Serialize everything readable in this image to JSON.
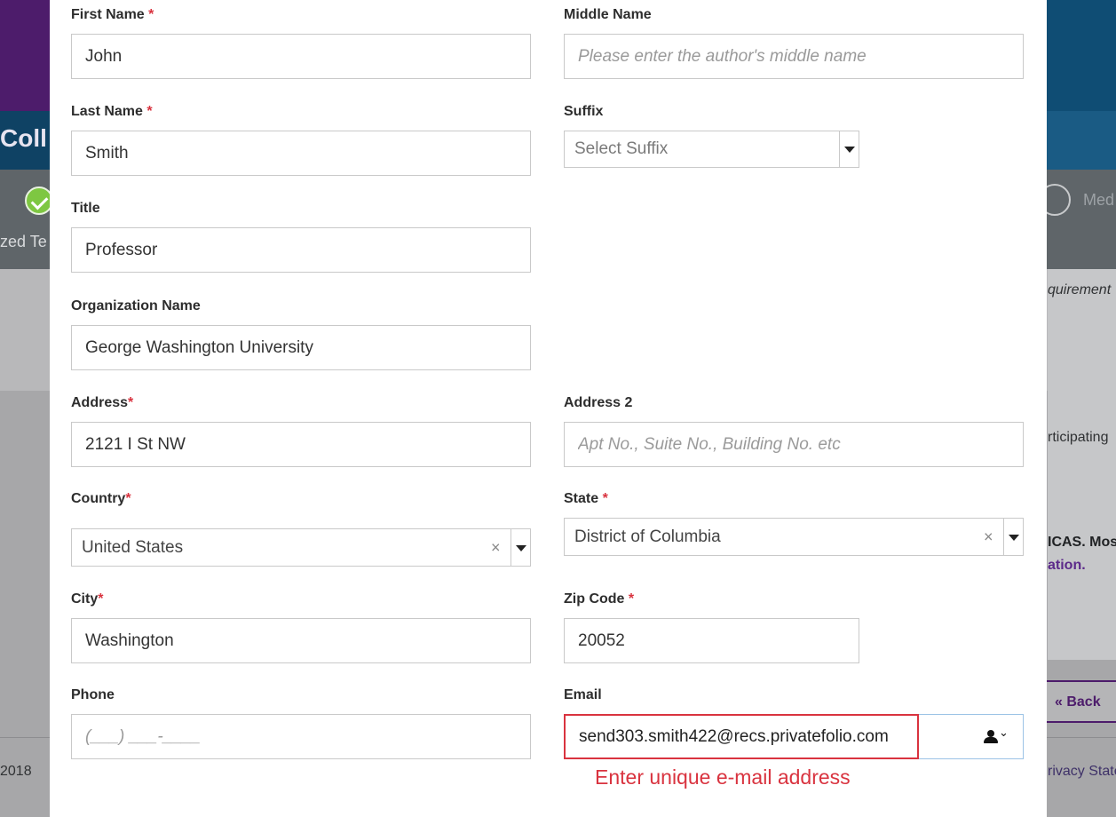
{
  "background": {
    "page_title_fragment": "Coll",
    "step_left_label": "zed Te",
    "step_right_label": "Med",
    "text_requirement": "quirement",
    "text_participating": "rticipating",
    "text_icas": "ICAS. Mos",
    "text_ation": "ation.",
    "back_button": "« Back",
    "footer_year": "2018",
    "footer_privacy": "rivacy State"
  },
  "form": {
    "first_name": {
      "label": "First Name",
      "required_mark": "*",
      "value": "John"
    },
    "middle_name": {
      "label": "Middle Name",
      "placeholder": "Please enter the author's middle name"
    },
    "last_name": {
      "label": "Last Name",
      "required_mark": "*",
      "value": "Smith"
    },
    "suffix": {
      "label": "Suffix",
      "placeholder": "Select Suffix"
    },
    "title": {
      "label": "Title",
      "value": "Professor"
    },
    "organization": {
      "label": "Organization Name",
      "value": "George Washington University"
    },
    "address": {
      "label": "Address",
      "required_mark": "*",
      "value": "2121 I St NW"
    },
    "address2": {
      "label": "Address 2",
      "placeholder": "Apt No., Suite No., Building No. etc"
    },
    "country": {
      "label": "Country",
      "required_mark": "*",
      "value": "United States",
      "clear": "×"
    },
    "state": {
      "label": "State",
      "required_mark": "*",
      "value": "District of Columbia",
      "clear": "×"
    },
    "city": {
      "label": "City",
      "required_mark": "*",
      "value": "Washington"
    },
    "zip": {
      "label": "Zip Code",
      "required_mark": "*",
      "value": "20052"
    },
    "phone": {
      "label": "Phone",
      "placeholder": "(___) ___-____"
    },
    "email": {
      "label": "Email",
      "value": "send303.smith422@recs.privatefolio.com",
      "error": "Enter unique e-mail address",
      "addon_chevron": "⌄"
    }
  },
  "colors": {
    "required": "#d9333f",
    "header_purple": "#4d1c6b",
    "header_blue": "#1a5b84",
    "success_green": "#7ec742"
  }
}
